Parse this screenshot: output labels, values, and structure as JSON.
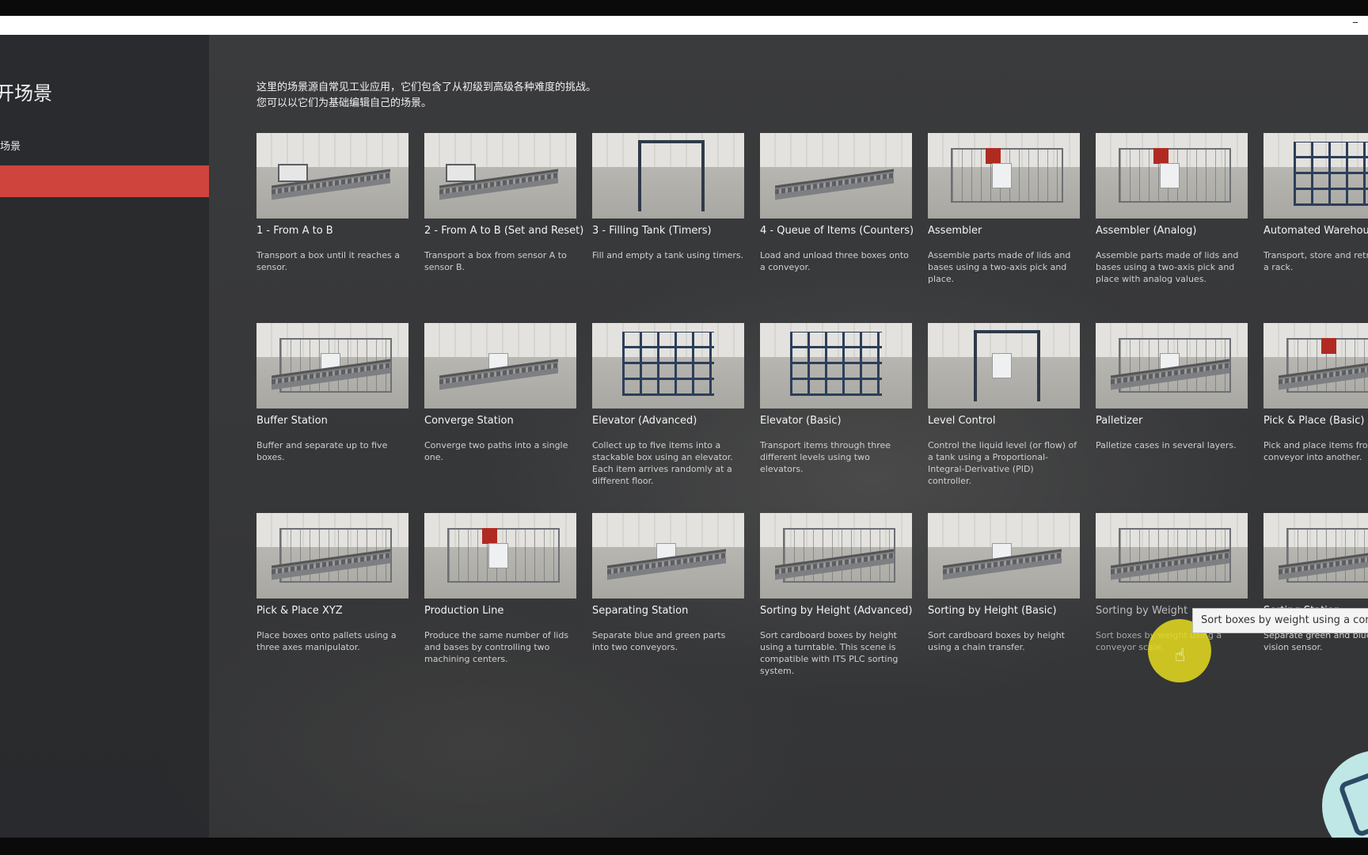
{
  "window": {
    "minimize_label": "–"
  },
  "sidebar": {
    "title": "开场景",
    "item": "场景"
  },
  "intro": {
    "line1": "这里的场景源自常见工业应用，它们包含了从初级到高级各种难度的挑战。",
    "line2": "您可以以它们为基础编辑自己的场景。"
  },
  "scenes": [
    {
      "title": "1 - From A to B",
      "desc": "Transport a box until it reaches a sensor."
    },
    {
      "title": "2 - From A to B (Set and Reset)",
      "desc": "Transport a box from sensor A to sensor B."
    },
    {
      "title": "3 - Filling Tank (Timers)",
      "desc": "Fill and empty a tank using timers."
    },
    {
      "title": "4 - Queue of Items (Counters)",
      "desc": "Load and unload three boxes onto a conveyor."
    },
    {
      "title": "Assembler",
      "desc": "Assemble parts made of lids and bases using a two-axis pick and place."
    },
    {
      "title": "Assembler (Analog)",
      "desc": "Assemble parts made of lids and bases using a two-axis pick and place with analog values."
    },
    {
      "title": "Automated Warehouse",
      "desc": "Transport, store and retrieve from a rack."
    },
    {
      "title": "Buffer Station",
      "desc": "Buffer and separate up to five boxes."
    },
    {
      "title": "Converge Station",
      "desc": "Converge two paths into a single one."
    },
    {
      "title": "Elevator (Advanced)",
      "desc": "Collect up to five items into a stackable box using an elevator. Each item arrives randomly at a different floor."
    },
    {
      "title": "Elevator (Basic)",
      "desc": "Transport items through three different levels using two elevators."
    },
    {
      "title": "Level Control",
      "desc": "Control the liquid level (or flow) of a tank using a Proportional-Integral-Derivative (PID) controller."
    },
    {
      "title": "Palletizer",
      "desc": "Palletize cases in several layers."
    },
    {
      "title": "Pick & Place (Basic)",
      "desc": "Pick and place items from conveyor into another."
    },
    {
      "title": "Pick & Place XYZ",
      "desc": "Place boxes onto pallets using a three axes manipulator."
    },
    {
      "title": "Production Line",
      "desc": "Produce the same number of lids and bases by controlling two machining centers."
    },
    {
      "title": "Separating Station",
      "desc": "Separate blue and green parts into two conveyors."
    },
    {
      "title": "Sorting by Height (Advanced)",
      "desc": "Sort cardboard boxes by height using a turntable. This scene is compatible with ITS PLC sorting system."
    },
    {
      "title": "Sorting by Height (Basic)",
      "desc": "Sort cardboard boxes by height using a chain transfer."
    },
    {
      "title": "Sorting by Weight",
      "desc": "Sort boxes by weight using a conveyor scale."
    },
    {
      "title": "Sorting Station",
      "desc": "Separate green and blue using a vision sensor."
    }
  ],
  "tooltip": "Sort boxes by weight using a conve"
}
